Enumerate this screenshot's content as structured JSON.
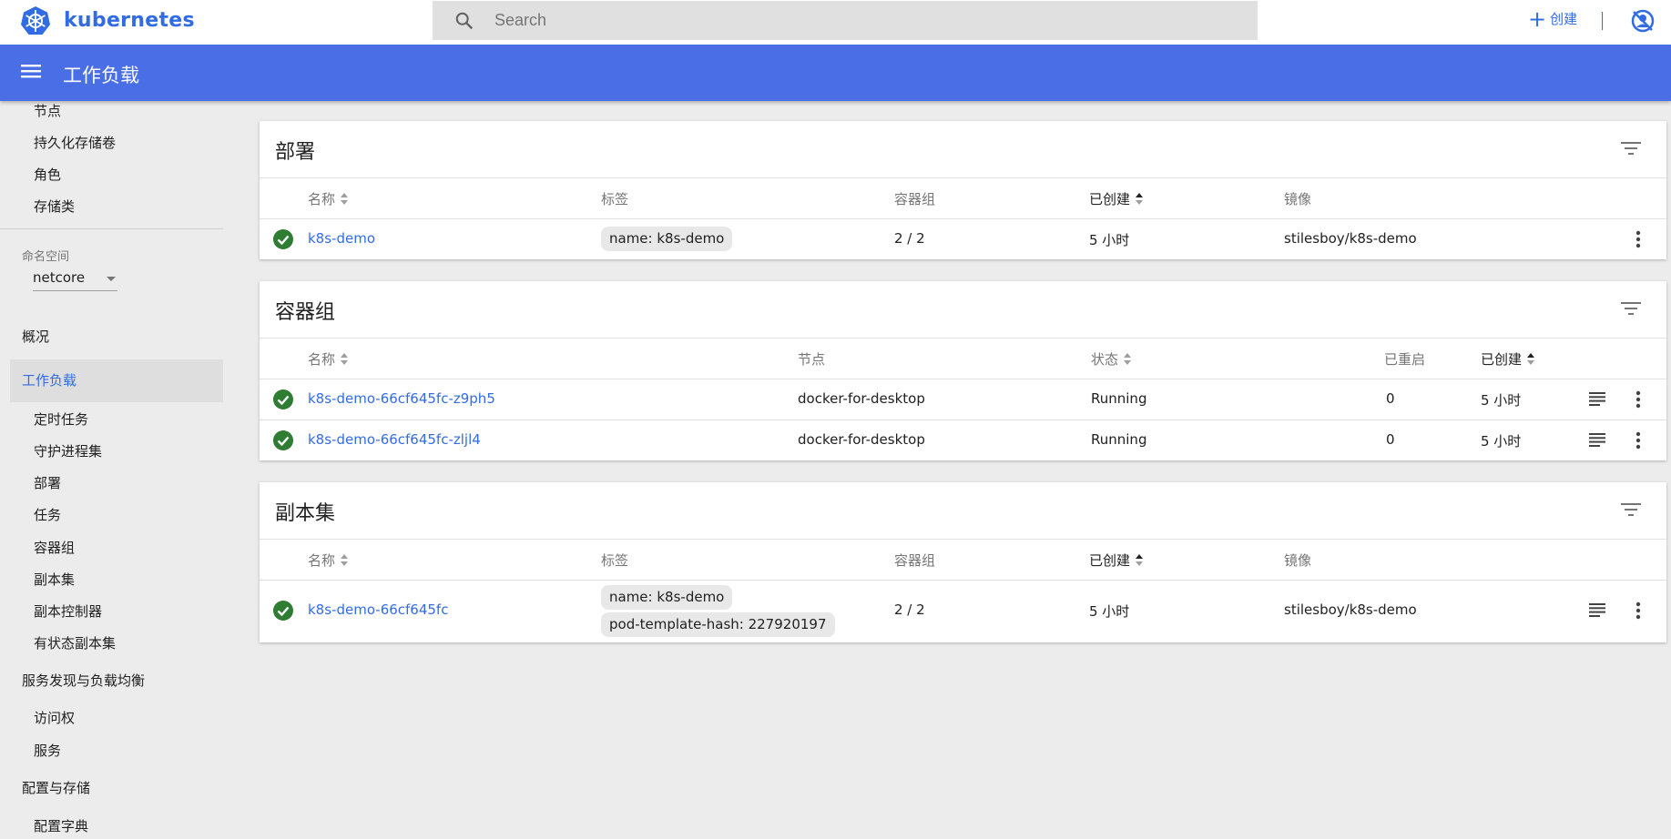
{
  "topbar": {
    "brand": "kubernetes",
    "search_placeholder": "Search",
    "create_label": "创建"
  },
  "header": {
    "title": "工作负载"
  },
  "sidebar": {
    "cluster_items": [
      "节点",
      "持久化存储卷",
      "角色",
      "存储类"
    ],
    "namespace_label": "命名空间",
    "namespace_value": "netcore",
    "overview": "概况",
    "workloads": "工作负载",
    "workload_items": [
      "定时任务",
      "守护进程集",
      "部署",
      "任务",
      "容器组",
      "副本集",
      "副本控制器",
      "有状态副本集"
    ],
    "discovery": "服务发现与负载均衡",
    "discovery_items": [
      "访问权",
      "服务"
    ],
    "config": "配置与存储",
    "config_items": [
      "配置字典"
    ]
  },
  "deployments": {
    "title": "部署",
    "headers": {
      "name": "名称",
      "labels": "标签",
      "pods": "容器组",
      "created": "已创建",
      "images": "镜像"
    },
    "rows": [
      {
        "name": "k8s-demo",
        "label": "name: k8s-demo",
        "pods": "2 / 2",
        "created": "5 小时",
        "image": "stilesboy/k8s-demo"
      }
    ]
  },
  "pods": {
    "title": "容器组",
    "headers": {
      "name": "名称",
      "node": "节点",
      "status": "状态",
      "restarts": "已重启",
      "created": "已创建"
    },
    "rows": [
      {
        "name": "k8s-demo-66cf645fc-z9ph5",
        "node": "docker-for-desktop",
        "status": "Running",
        "restarts": "0",
        "created": "5 小时"
      },
      {
        "name": "k8s-demo-66cf645fc-zljl4",
        "node": "docker-for-desktop",
        "status": "Running",
        "restarts": "0",
        "created": "5 小时"
      }
    ]
  },
  "replicasets": {
    "title": "副本集",
    "headers": {
      "name": "名称",
      "labels": "标签",
      "pods": "容器组",
      "created": "已创建",
      "images": "镜像"
    },
    "rows": [
      {
        "name": "k8s-demo-66cf645fc",
        "labels": [
          "name: k8s-demo",
          "pod-template-hash: 227920197"
        ],
        "pods": "2 / 2",
        "created": "5 小时",
        "image": "stilesboy/k8s-demo"
      }
    ]
  },
  "colors": {
    "accent": "#326ce5",
    "header": "#4a6ee6",
    "success": "#2e7d32"
  }
}
